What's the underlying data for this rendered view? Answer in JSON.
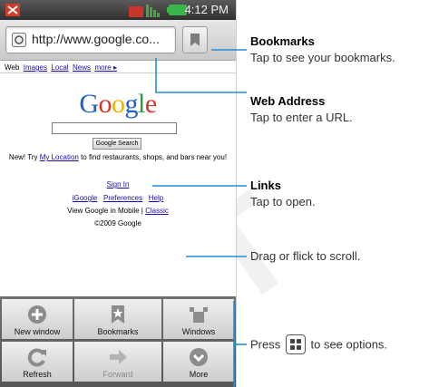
{
  "status_bar": {
    "time": "4:12 PM"
  },
  "browser": {
    "url": "http://www.google.co..."
  },
  "search_links": {
    "web": "Web",
    "images": "Images",
    "local": "Local",
    "news": "News",
    "more": "more ▸"
  },
  "google": {
    "logo": "Google",
    "search_button": "Google Search",
    "promo_prefix": "New! Try ",
    "promo_link": "My Location",
    "promo_suffix": " to find restaurants, shops, and bars near you!",
    "sign_in": "Sign In",
    "igoogle": "iGoogle",
    "preferences": "Preferences",
    "help": "Help",
    "view_prefix": "View Google in Mobile | ",
    "classic": "Classic",
    "copyright": "©2009 Google"
  },
  "menu": {
    "new_window": "New window",
    "bookmarks": "Bookmarks",
    "windows": "Windows",
    "refresh": "Refresh",
    "forward": "Forward",
    "more": "More"
  },
  "callouts": {
    "bookmarks_title": "Bookmarks",
    "bookmarks_text": "Tap to see your bookmarks.",
    "address_title": "Web Address",
    "address_text": "Tap to enter a URL.",
    "links_title": "Links",
    "links_text": "Tap to open.",
    "scroll_text": "Drag or flick to scroll.",
    "press_prefix": "Press",
    "press_suffix": "to see options."
  },
  "colors": {
    "callout_line": "#1e8fd6",
    "link": "#1a0dab",
    "battery": "#39b54a"
  }
}
